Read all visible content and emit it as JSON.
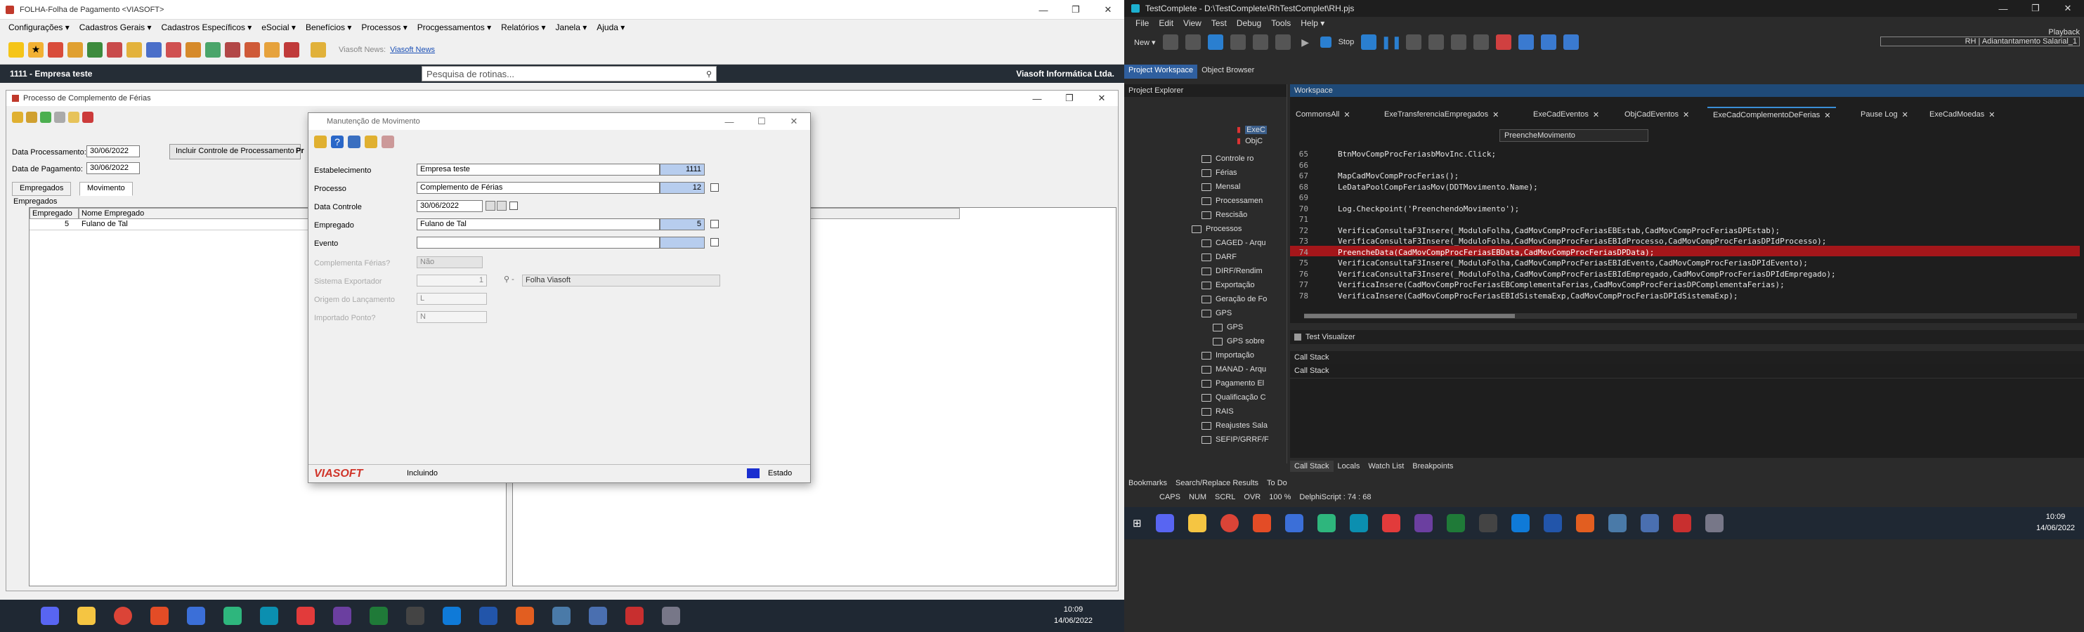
{
  "left_app": {
    "window_title": "FOLHA-Folha de Pagamento <VIASOFT>",
    "menu": [
      "Configurações ▾",
      "Cadastros Gerais ▾",
      "Cadastros Específicos ▾",
      "eSocial ▾",
      "Benefícios ▾",
      "Processos ▾",
      "Procgessamentos ▾",
      "Relatórios ▾",
      "Janela ▾",
      "Ajuda ▾"
    ],
    "news_label": "Viasoft News:",
    "news_link": "Viasoft News",
    "company": "1111 - Empresa teste",
    "search_placeholder": "Pesquisa de rotinas...",
    "company_right": "Viasoft Informática Ltda.",
    "child_window": {
      "title": "Processo de Complemento de Férias",
      "data_processamento_label": "Data Processamento:",
      "data_processamento": "30/06/2022",
      "data_pagamento_label": "Data de Pagamento:",
      "data_pagamento": "30/06/2022",
      "incluir_btn": "Incluir Controle de Processamento",
      "pr_trunc": "Pr",
      "tabs": [
        "Empregados",
        "Movimento"
      ],
      "group_label": "Empregados",
      "grid_headers": [
        "Empregado",
        "Nome Empregado"
      ],
      "grid_row": {
        "id": "5",
        "name": "Fulano de Tal"
      }
    },
    "modal": {
      "title": "Manutenção de Movimento",
      "estabelecimento_label": "Estabelecimento",
      "estabelecimento": "Empresa teste",
      "estabelecimento_code": "1111",
      "processo_label": "Processo",
      "processo": "Complemento de Férias",
      "processo_code": "12",
      "data_controle_label": "Data Controle",
      "data_controle": "30/06/2022",
      "empregado_label": "Empregado",
      "empregado": "Fulano de Tal",
      "empregado_code": "5",
      "evento_label": "Evento",
      "complementa_label": "Complementa Férias?",
      "complementa": "Não",
      "sistema_label": "Sistema Exportador",
      "sistema_code": "1",
      "sistema_name": "Folha Viasoft",
      "origem_label": "Origem do Lançamento",
      "origem": "L",
      "importado_label": "Importado Ponto?",
      "importado": "N",
      "footer_logo": "VIASOFT",
      "footer_status": "Incluindo",
      "footer_estado": "Estado"
    },
    "clock_time": "10:09",
    "clock_date": "14/06/2022"
  },
  "right_app": {
    "window_title": "TestComplete - D:\\TestComplete\\RhTestComplet\\RH.pjs",
    "menu": [
      "File",
      "Edit",
      "View",
      "Test",
      "Debug",
      "Tools",
      "Help ▾"
    ],
    "toolbar_new": "New ▾",
    "toolbar_stop": "Stop",
    "playback_label": "Playback",
    "playback_sub": "RH | Adiantantamento Salarial_1",
    "tab_project_workspace": "Project Workspace",
    "tab_object_browser": "Object Browser",
    "project_explorer_title": "Project Explorer",
    "workspace_title": "Workspace",
    "editor_tabs": [
      "CommonsAll",
      "ExeTransferenciaEmpregados",
      "ExeCadEventos",
      "ObjCadEventos",
      "ExeCadComplementoDeFerias",
      "Pause Log",
      "ExeCadMoedas"
    ],
    "routine_dropdown": "PreencheMovimento",
    "tree": [
      "ExeC",
      "ObjC",
      "Controle ro",
      "Férias",
      "Mensal",
      "Processamen",
      "Rescisão",
      "Processos",
      "CAGED - Arqu",
      "DARF",
      "DIRF/Rendim",
      "Exportação",
      "Geração de Fo",
      "GPS",
      "GPS",
      "GPS sobre",
      "Importação",
      "MANAD - Arqu",
      "Pagamento El",
      "Qualificação C",
      "RAIS",
      "Reajustes Sala",
      "SEFIP/GRRF/F"
    ],
    "code_lines": [
      {
        "n": "65",
        "t": "BtnMovCompProcFeriasbMovInc.Click;"
      },
      {
        "n": "66",
        "t": ""
      },
      {
        "n": "67",
        "t": "MapCadMovCompProcFerias();"
      },
      {
        "n": "68",
        "t": "LeDataPoolCompFeriasMov(DDTMovimento.Name);"
      },
      {
        "n": "69",
        "t": ""
      },
      {
        "n": "70",
        "t": "Log.Checkpoint('PreenchendoMovimento');"
      },
      {
        "n": "71",
        "t": ""
      },
      {
        "n": "72",
        "t": "VerificaConsultaF3Insere(_ModuloFolha,CadMovCompProcFeriasEBEstab,CadMovCompProcFeriasDPEstab);"
      },
      {
        "n": "73",
        "t": "VerificaConsultaF3Insere(_ModuloFolha,CadMovCompProcFeriasEBIdProcesso,CadMovCompProcFeriasDPIdProcesso);"
      },
      {
        "n": "74",
        "t": "PreencheData(CadMovCompProcFeriasEBData,CadMovCompProcFeriasDPData);"
      },
      {
        "n": "75",
        "t": "VerificaConsultaF3Insere(_ModuloFolha,CadMovCompProcFeriasEBIdEvento,CadMovCompProcFeriasDPIdEvento);"
      },
      {
        "n": "76",
        "t": "VerificaConsultaF3Insere(_ModuloFolha,CadMovCompProcFeriasEBIdEmpregado,CadMovCompProcFeriasDPIdEmpregado);"
      },
      {
        "n": "77",
        "t": "VerificaInsere(CadMovCompProcFeriasEBComplementaFerias,CadMovCompProcFeriasDPComplementaFerias);"
      },
      {
        "n": "78",
        "t": "VerificaInsere(CadMovCompProcFeriasEBIdSistemaExp,CadMovCompProcFeriasDPIdSistemaExp);"
      }
    ],
    "test_visualizer": "Test Visualizer",
    "call_stack_title": "Call Stack",
    "call_stack_col": "Call Stack",
    "bottom_tabs": [
      "Call Stack",
      "Locals",
      "Watch List",
      "Breakpoints"
    ],
    "left_bottom_tabs": [
      "Bookmarks",
      "Search/Replace Results",
      "To Do"
    ],
    "status": [
      "CAPS",
      "NUM",
      "SCRL",
      "OVR",
      "100 %",
      "DelphiScript :  74 : 68"
    ],
    "clock_time": "10:09",
    "clock_date": "14/06/2022"
  }
}
